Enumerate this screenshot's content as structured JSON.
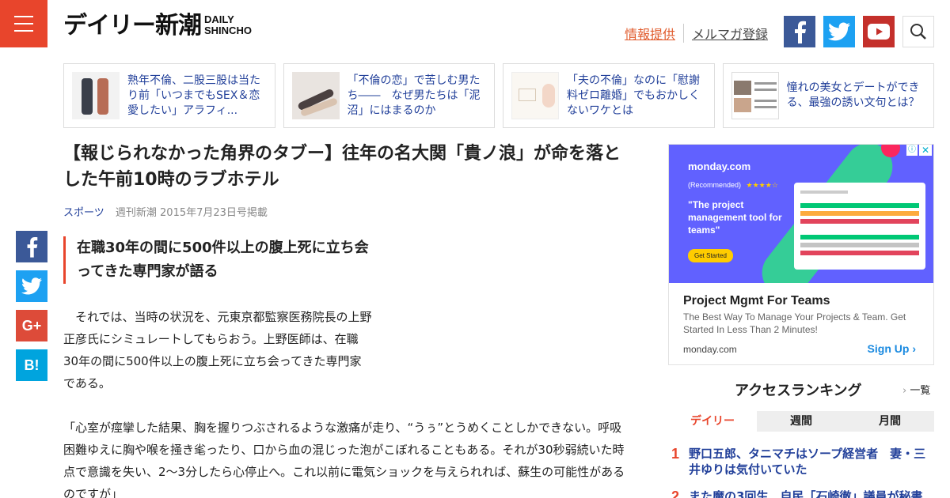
{
  "header": {
    "logo_jp": "デイリー新潮",
    "logo_en_line1": "DAILY",
    "logo_en_line2": "SHINCHO",
    "link_info": "情報提供",
    "link_mailmag": "メルマガ登録"
  },
  "cards": [
    {
      "text": "熟年不倫、二股三股は当たり前「いつまでもSEX＆恋愛したい」アラフィ..."
    },
    {
      "text": "「不倫の恋」で苦しむ男たち――　なぜ男たちは「泥沼」にはまるのか"
    },
    {
      "text": "「夫の不倫」なのに「慰謝料ゼロ離婚」でもおかしくないワケとは"
    },
    {
      "text": "憧れの美女とデートができる、最強の誘い文句とは？"
    }
  ],
  "article": {
    "title": "【報じられなかった角界のタブー】往年の名大関「貴ノ浪」が命を落とした午前10時のラブホテル",
    "category": "スポーツ",
    "source": "週刊新潮 2015年7月23日号掲載",
    "subheading": "在職30年の間に500件以上の腹上死に立ち会ってきた専門家が語る",
    "para1": "　それでは、当時の状況を、元東京都監察医務院長の上野正彦氏にシミュレートしてもらおう。上野医師は、在職30年の間に500件以上の腹上死に立ち会ってきた専門家である。",
    "para2": "「心室が痙攣した結果、胸を握りつぶされるような激痛が走り、“うぅ”とうめくことしかできない。呼吸困難ゆえに胸や喉を掻き毟ったり、口から血の混じった泡がこぼれることもある。それが30秒弱続いた時点で意識を失い、2～3分したら心停止へ。これ以前に電気ショックを与えられれば、蘇生の可能性があるのですが」"
  },
  "share": {
    "fb": "f",
    "gplus": "G+",
    "hatena": "B!"
  },
  "ad": {
    "brand": "monday.com",
    "recommended": "(Recommended)",
    "stars": "★★★★☆",
    "quote": "\"The project management tool for teams\"",
    "cta": "Get Started",
    "headline": "Project Mgmt For Teams",
    "description": "The Best Way To Manage Your Projects & Team. Get Started In Less Than 2 Minutes!",
    "domain": "monday.com",
    "signup": "Sign Up"
  },
  "ranking": {
    "title": "アクセスランキング",
    "more": "一覧",
    "tabs": [
      "デイリー",
      "週間",
      "月間"
    ],
    "active_tab": 0,
    "items": [
      {
        "num": "1",
        "text": "野口五郎、タニマチはソープ経営者　妻・三井ゆりは気付いていた"
      },
      {
        "num": "2",
        "text": "また魔の3回生　自民「石崎徹」議員が秘書にパ"
      }
    ]
  },
  "colors": {
    "accent": "#e8452c",
    "link": "#22409a",
    "facebook": "#3b5998",
    "twitter": "#1da1f2",
    "youtube": "#c4302b",
    "hatena": "#00a4de",
    "gplus": "#dd4b39",
    "ad_bg": "#6161ff"
  },
  "icons": [
    "menu-icon",
    "facebook-icon",
    "twitter-icon",
    "youtube-icon",
    "search-icon",
    "google-plus-icon",
    "hatena-bookmark-icon",
    "chevron-right-icon"
  ]
}
